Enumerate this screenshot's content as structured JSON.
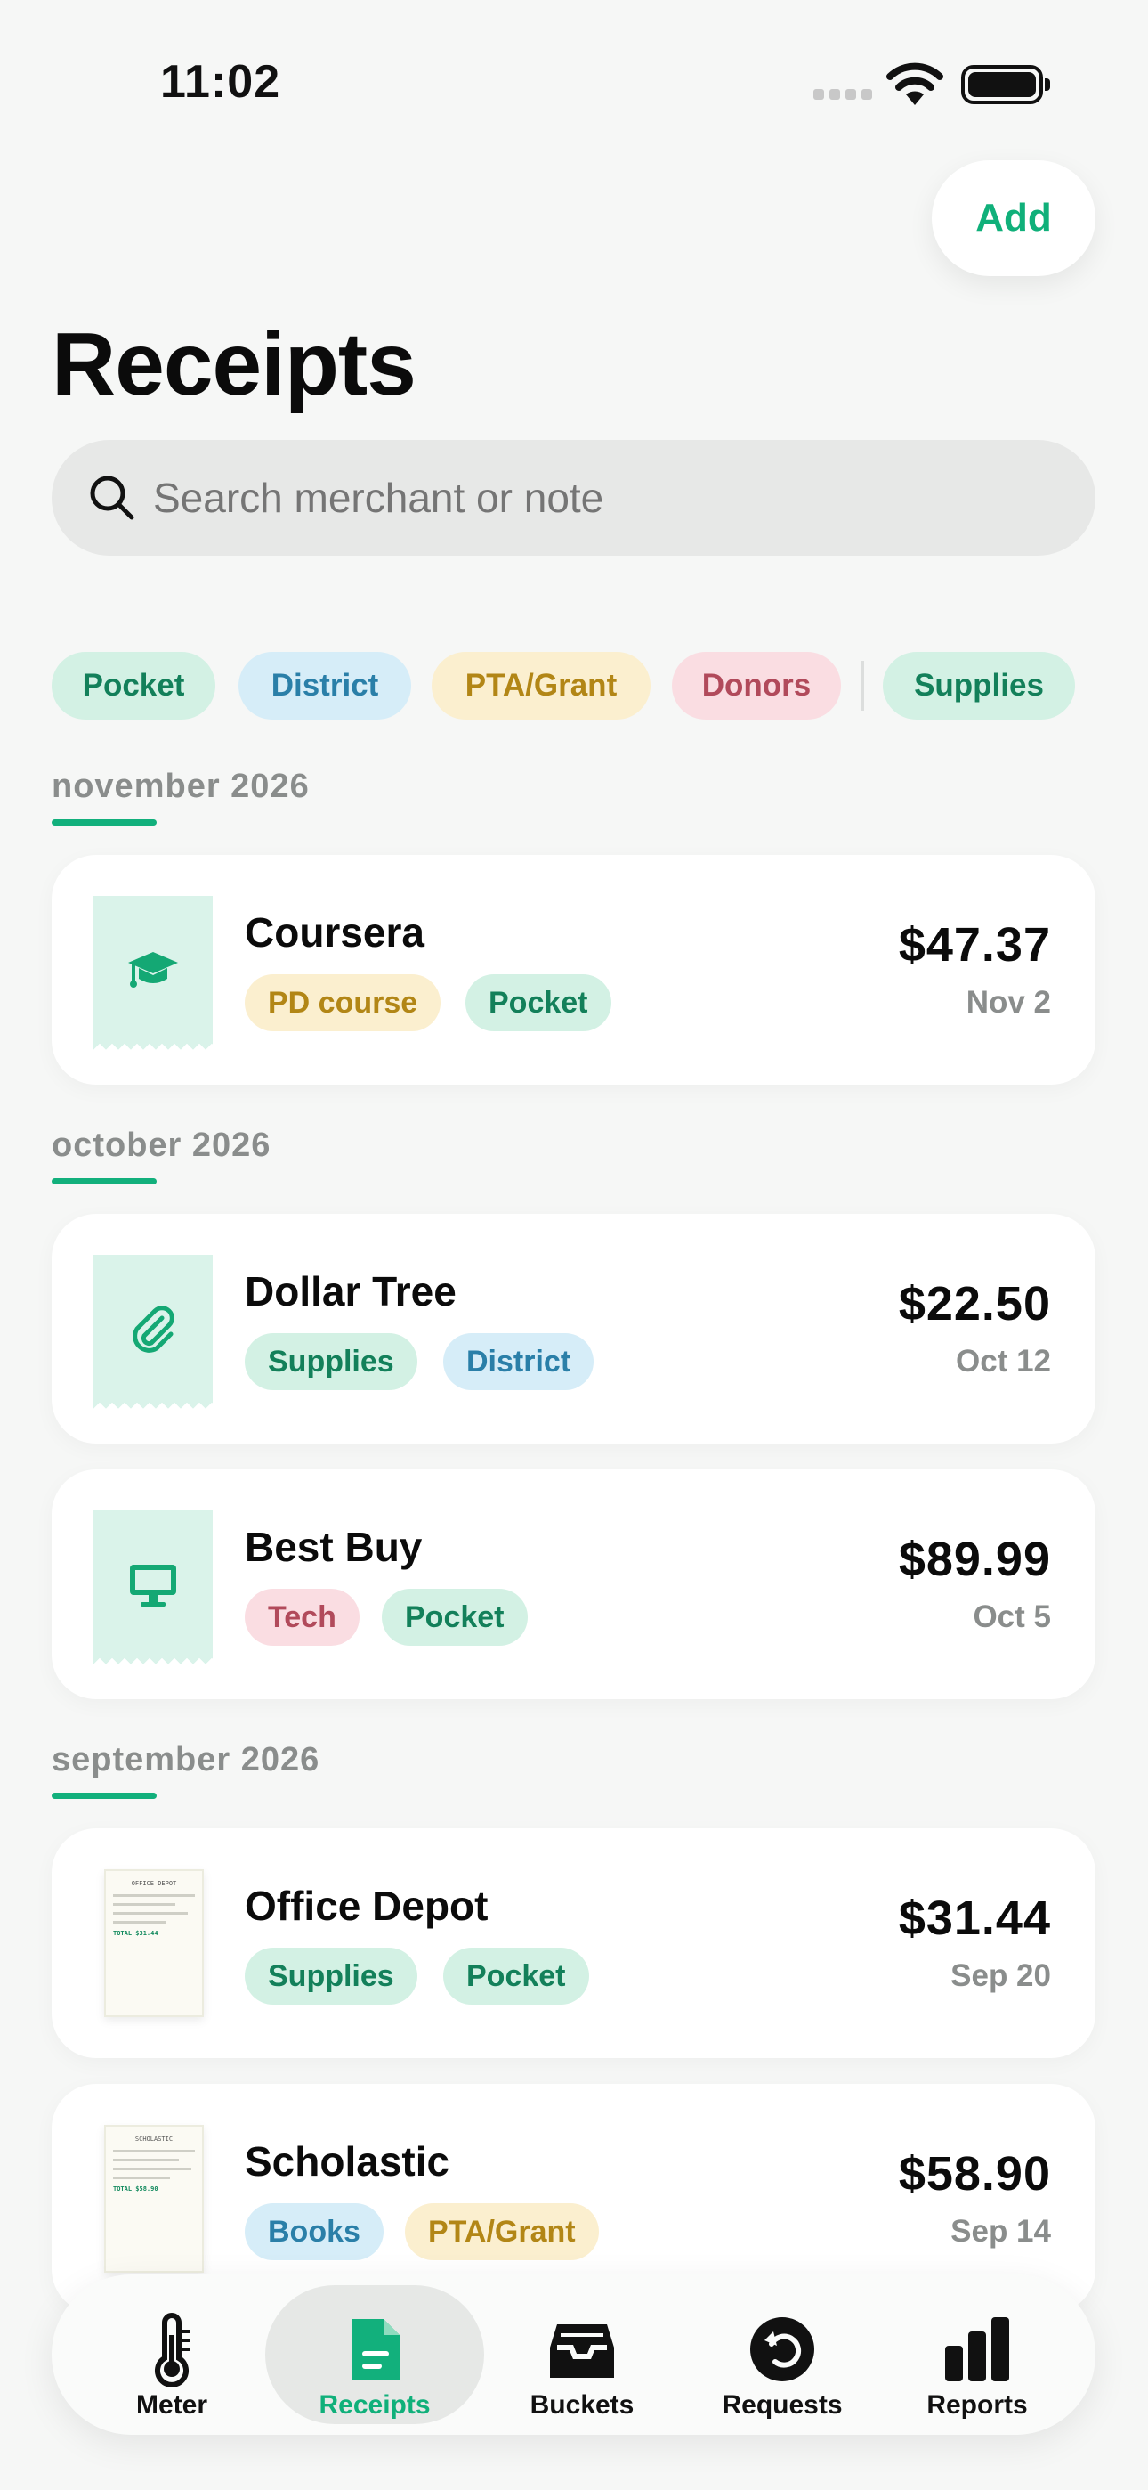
{
  "status_bar": {
    "time": "11:02"
  },
  "header": {
    "add_label": "Add",
    "title": "Receipts"
  },
  "search": {
    "placeholder": "Search merchant or note"
  },
  "filters": [
    {
      "label": "Pocket"
    },
    {
      "label": "District"
    },
    {
      "label": "PTA/Grant"
    },
    {
      "label": "Donors"
    },
    {
      "label": "Supplies"
    }
  ],
  "sections": [
    {
      "label": "november 2026"
    },
    {
      "label": "october 2026"
    },
    {
      "label": "september 2026"
    }
  ],
  "receipts": [
    {
      "merchant": "Coursera",
      "amount": "$47.37",
      "date": "Nov 2",
      "tags": [
        "PD course",
        "Pocket"
      ],
      "icon": "graduation-cap-icon"
    },
    {
      "merchant": "Dollar Tree",
      "amount": "$22.50",
      "date": "Oct 12",
      "tags": [
        "Supplies",
        "District"
      ],
      "icon": "paperclip-icon"
    },
    {
      "merchant": "Best Buy",
      "amount": "$89.99",
      "date": "Oct 5",
      "tags": [
        "Tech",
        "Pocket"
      ],
      "icon": "monitor-icon"
    },
    {
      "merchant": "Office Depot",
      "amount": "$31.44",
      "date": "Sep 20",
      "tags": [
        "Supplies",
        "Pocket"
      ],
      "icon": "receipt-photo",
      "receipt_header": "OFFICE DEPOT",
      "receipt_total": "TOTAL $31.44"
    },
    {
      "merchant": "Scholastic",
      "amount": "$58.90",
      "date": "Sep 14",
      "tags": [
        "Books",
        "PTA/Grant"
      ],
      "icon": "receipt-photo",
      "receipt_header": "SCHOLASTIC",
      "receipt_total": "TOTAL $58.90"
    }
  ],
  "tabs": [
    {
      "label": "Meter",
      "icon": "thermometer-icon"
    },
    {
      "label": "Receipts",
      "icon": "receipt-doc-icon",
      "active": true
    },
    {
      "label": "Buckets",
      "icon": "inbox-tray-icon"
    },
    {
      "label": "Requests",
      "icon": "return-arrow-icon"
    },
    {
      "label": "Reports",
      "icon": "bar-chart-icon"
    }
  ],
  "colors": {
    "accent": "#10b07a",
    "green_chip_bg": "#d3f1e4",
    "green_chip_text": "#13805a",
    "blue_chip_bg": "#d6edf8",
    "blue_chip_text": "#2a7fa8",
    "yellow_chip_bg": "#fbefcf",
    "yellow_chip_text": "#b28616",
    "red_chip_bg": "#fadde2",
    "red_chip_text": "#b14a5b"
  }
}
